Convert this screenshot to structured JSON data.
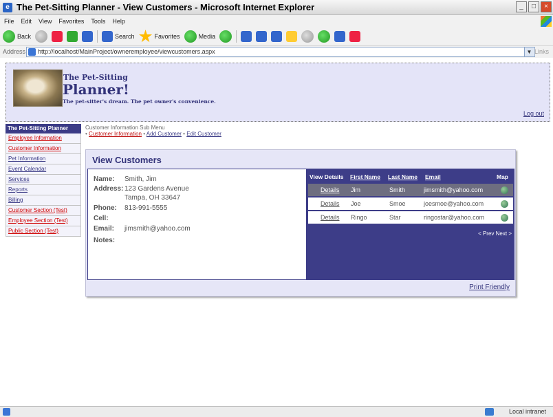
{
  "window": {
    "title": "The Pet-Sitting Planner - View Customers - Microsoft Internet Explorer",
    "minimize": "_",
    "maximize": "□",
    "close": "×"
  },
  "menubar": [
    "File",
    "Edit",
    "View",
    "Favorites",
    "Tools",
    "Help"
  ],
  "toolbar": {
    "back": "Back",
    "search": "Search",
    "favorites": "Favorites",
    "media": "Media"
  },
  "address": {
    "label": "Address",
    "url": "http://localhost/MainProject/owneremployee/viewcustomers.aspx",
    "links": "Links"
  },
  "header": {
    "brand_top": "The Pet-Sitting",
    "brand_main": "Planner!",
    "tagline": "The pet-sitter's dream. The pet owner's convenience.",
    "logout": "Log out"
  },
  "sidenav": {
    "title": "The Pet-Sitting Planner",
    "items": [
      {
        "label": "Employee Information",
        "color": "red"
      },
      {
        "label": "Customer Information",
        "color": "red"
      },
      {
        "label": "Pet Information",
        "color": "blue"
      },
      {
        "label": "Event Calendar",
        "color": "blue"
      },
      {
        "label": "Services",
        "color": "blue"
      },
      {
        "label": "Reports",
        "color": "blue"
      },
      {
        "label": "Billing",
        "color": "blue"
      },
      {
        "label": "Customer Section (Test)",
        "color": "red"
      },
      {
        "label": "Employee Section (Test)",
        "color": "red"
      },
      {
        "label": "Public Section (Test)",
        "color": "red"
      }
    ]
  },
  "submenu": {
    "title": "Customer Information Sub Menu",
    "bullet": "•",
    "sep": "•",
    "links": [
      "Customer Information",
      "Add Customer",
      "Edit Customer"
    ]
  },
  "panel": {
    "title": "View Customers",
    "footer_link": "Print Friendly"
  },
  "customer_detail": {
    "name_label": "Name:",
    "name": "Smith, Jim",
    "address_label": "Address:",
    "address_line1": "123 Gardens Avenue",
    "address_line2": "Tampa, OH 33647",
    "phone_label": "Phone:",
    "phone": "813-991-5555",
    "cell_label": "Cell:",
    "cell": "",
    "email_label": "Email:",
    "email": "jimsmith@yahoo.com",
    "notes_label": "Notes:",
    "notes": ""
  },
  "grid": {
    "headers": {
      "details": "View Details",
      "first": "First Name",
      "last": "Last Name",
      "email": "Email",
      "map": "Map"
    },
    "rows": [
      {
        "details": "Details",
        "first": "Jim",
        "last": "Smith",
        "email": "jimsmith@yahoo.com",
        "selected": true
      },
      {
        "details": "Details",
        "first": "Joe",
        "last": "Smoe",
        "email": "joesmoe@yahoo.com",
        "selected": false
      },
      {
        "details": "Details",
        "first": "Ringo",
        "last": "Star",
        "email": "ringostar@yahoo.com",
        "selected": false
      }
    ],
    "pager": "< Prev Next >"
  },
  "statusbar": {
    "zone": "Local intranet"
  }
}
